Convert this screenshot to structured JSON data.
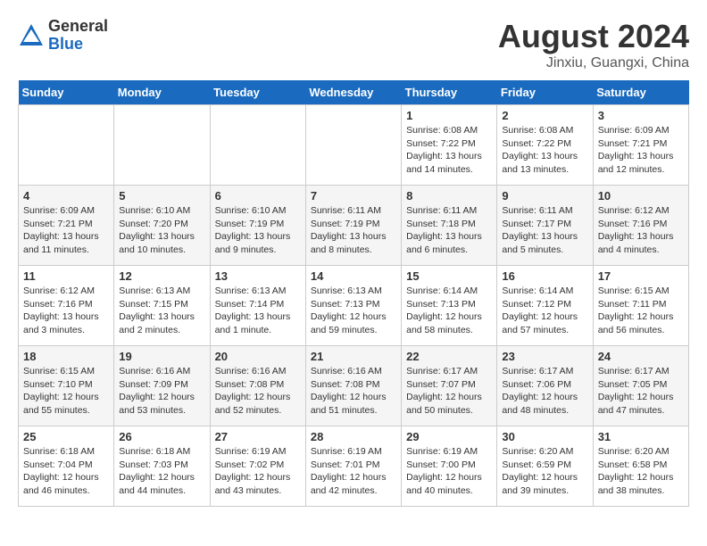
{
  "logo": {
    "general": "General",
    "blue": "Blue"
  },
  "header": {
    "month_year": "August 2024",
    "location": "Jinxiu, Guangxi, China"
  },
  "days_of_week": [
    "Sunday",
    "Monday",
    "Tuesday",
    "Wednesday",
    "Thursday",
    "Friday",
    "Saturday"
  ],
  "weeks": [
    [
      {
        "day": "",
        "info": ""
      },
      {
        "day": "",
        "info": ""
      },
      {
        "day": "",
        "info": ""
      },
      {
        "day": "",
        "info": ""
      },
      {
        "day": "1",
        "info": "Sunrise: 6:08 AM\nSunset: 7:22 PM\nDaylight: 13 hours\nand 14 minutes."
      },
      {
        "day": "2",
        "info": "Sunrise: 6:08 AM\nSunset: 7:22 PM\nDaylight: 13 hours\nand 13 minutes."
      },
      {
        "day": "3",
        "info": "Sunrise: 6:09 AM\nSunset: 7:21 PM\nDaylight: 13 hours\nand 12 minutes."
      }
    ],
    [
      {
        "day": "4",
        "info": "Sunrise: 6:09 AM\nSunset: 7:21 PM\nDaylight: 13 hours\nand 11 minutes."
      },
      {
        "day": "5",
        "info": "Sunrise: 6:10 AM\nSunset: 7:20 PM\nDaylight: 13 hours\nand 10 minutes."
      },
      {
        "day": "6",
        "info": "Sunrise: 6:10 AM\nSunset: 7:19 PM\nDaylight: 13 hours\nand 9 minutes."
      },
      {
        "day": "7",
        "info": "Sunrise: 6:11 AM\nSunset: 7:19 PM\nDaylight: 13 hours\nand 8 minutes."
      },
      {
        "day": "8",
        "info": "Sunrise: 6:11 AM\nSunset: 7:18 PM\nDaylight: 13 hours\nand 6 minutes."
      },
      {
        "day": "9",
        "info": "Sunrise: 6:11 AM\nSunset: 7:17 PM\nDaylight: 13 hours\nand 5 minutes."
      },
      {
        "day": "10",
        "info": "Sunrise: 6:12 AM\nSunset: 7:16 PM\nDaylight: 13 hours\nand 4 minutes."
      }
    ],
    [
      {
        "day": "11",
        "info": "Sunrise: 6:12 AM\nSunset: 7:16 PM\nDaylight: 13 hours\nand 3 minutes."
      },
      {
        "day": "12",
        "info": "Sunrise: 6:13 AM\nSunset: 7:15 PM\nDaylight: 13 hours\nand 2 minutes."
      },
      {
        "day": "13",
        "info": "Sunrise: 6:13 AM\nSunset: 7:14 PM\nDaylight: 13 hours\nand 1 minute."
      },
      {
        "day": "14",
        "info": "Sunrise: 6:13 AM\nSunset: 7:13 PM\nDaylight: 12 hours\nand 59 minutes."
      },
      {
        "day": "15",
        "info": "Sunrise: 6:14 AM\nSunset: 7:13 PM\nDaylight: 12 hours\nand 58 minutes."
      },
      {
        "day": "16",
        "info": "Sunrise: 6:14 AM\nSunset: 7:12 PM\nDaylight: 12 hours\nand 57 minutes."
      },
      {
        "day": "17",
        "info": "Sunrise: 6:15 AM\nSunset: 7:11 PM\nDaylight: 12 hours\nand 56 minutes."
      }
    ],
    [
      {
        "day": "18",
        "info": "Sunrise: 6:15 AM\nSunset: 7:10 PM\nDaylight: 12 hours\nand 55 minutes."
      },
      {
        "day": "19",
        "info": "Sunrise: 6:16 AM\nSunset: 7:09 PM\nDaylight: 12 hours\nand 53 minutes."
      },
      {
        "day": "20",
        "info": "Sunrise: 6:16 AM\nSunset: 7:08 PM\nDaylight: 12 hours\nand 52 minutes."
      },
      {
        "day": "21",
        "info": "Sunrise: 6:16 AM\nSunset: 7:08 PM\nDaylight: 12 hours\nand 51 minutes."
      },
      {
        "day": "22",
        "info": "Sunrise: 6:17 AM\nSunset: 7:07 PM\nDaylight: 12 hours\nand 50 minutes."
      },
      {
        "day": "23",
        "info": "Sunrise: 6:17 AM\nSunset: 7:06 PM\nDaylight: 12 hours\nand 48 minutes."
      },
      {
        "day": "24",
        "info": "Sunrise: 6:17 AM\nSunset: 7:05 PM\nDaylight: 12 hours\nand 47 minutes."
      }
    ],
    [
      {
        "day": "25",
        "info": "Sunrise: 6:18 AM\nSunset: 7:04 PM\nDaylight: 12 hours\nand 46 minutes."
      },
      {
        "day": "26",
        "info": "Sunrise: 6:18 AM\nSunset: 7:03 PM\nDaylight: 12 hours\nand 44 minutes."
      },
      {
        "day": "27",
        "info": "Sunrise: 6:19 AM\nSunset: 7:02 PM\nDaylight: 12 hours\nand 43 minutes."
      },
      {
        "day": "28",
        "info": "Sunrise: 6:19 AM\nSunset: 7:01 PM\nDaylight: 12 hours\nand 42 minutes."
      },
      {
        "day": "29",
        "info": "Sunrise: 6:19 AM\nSunset: 7:00 PM\nDaylight: 12 hours\nand 40 minutes."
      },
      {
        "day": "30",
        "info": "Sunrise: 6:20 AM\nSunset: 6:59 PM\nDaylight: 12 hours\nand 39 minutes."
      },
      {
        "day": "31",
        "info": "Sunrise: 6:20 AM\nSunset: 6:58 PM\nDaylight: 12 hours\nand 38 minutes."
      }
    ]
  ]
}
